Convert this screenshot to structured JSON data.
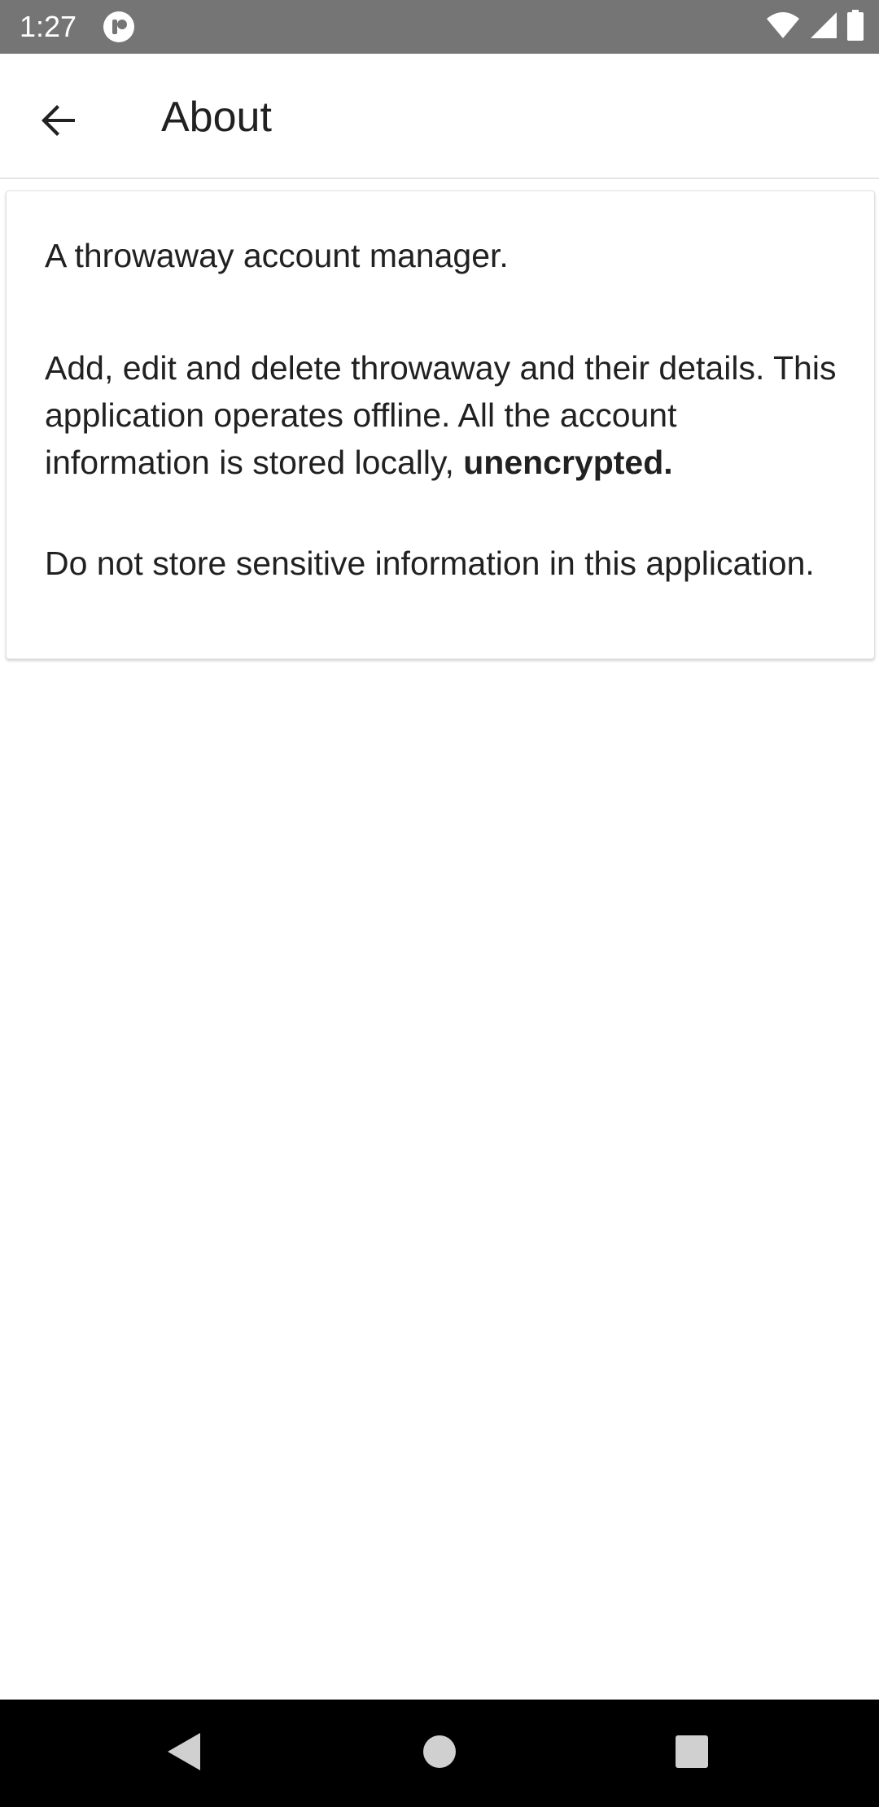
{
  "status_bar": {
    "time": "1:27",
    "icons": [
      "app-notification-icon",
      "wifi-icon",
      "cellular-signal-icon",
      "battery-icon"
    ]
  },
  "app_bar": {
    "back_icon": "arrow-back-icon",
    "title": "About"
  },
  "about_card": {
    "paragraph_1": "A throwaway account manager.",
    "paragraph_2": "Add, edit and delete throwaway and their details. This application operates offline. All the account information is stored locally, ",
    "paragraph_2_emphasis": "unencrypted.",
    "paragraph_3": "Do not store sensitive information in this application."
  },
  "navigation_bar": {
    "buttons": [
      "back-triangle-icon",
      "home-circle-icon",
      "recents-square-icon"
    ]
  },
  "colors": {
    "status_bar_bg": "#757575",
    "app_bar_bg": "#ffffff",
    "text_primary": "#212121",
    "nav_bar_bg": "#000000"
  }
}
